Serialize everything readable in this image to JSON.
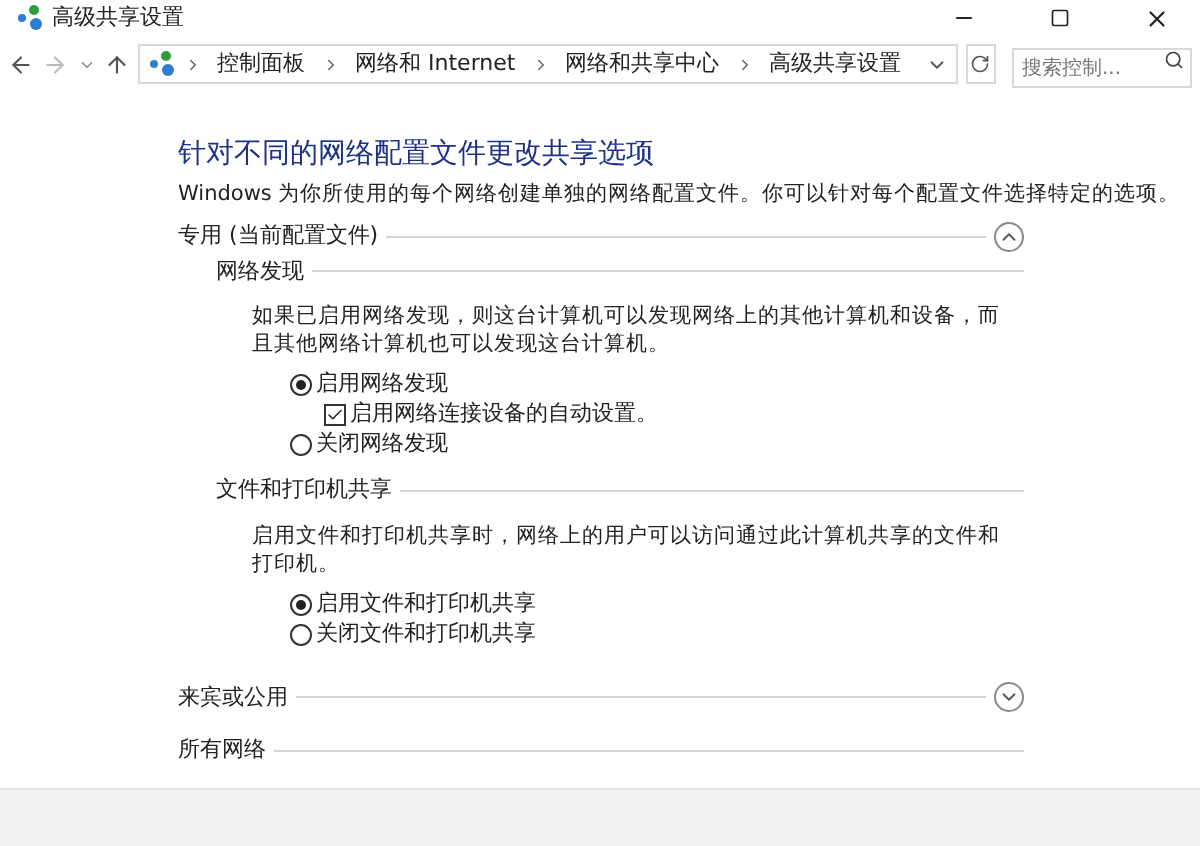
{
  "window": {
    "title": "高级共享设置"
  },
  "breadcrumb": [
    "控制面板",
    "网络和 Internet",
    "网络和共享中心",
    "高级共享设置"
  ],
  "search": {
    "placeholder": "搜索控制..."
  },
  "heading": "针对不同的网络配置文件更改共享选项",
  "description": "Windows 为你所使用的每个网络创建单独的网络配置文件。你可以针对每个配置文件选择特定的选项。",
  "sections": [
    {
      "title": "专用 (当前配置文件)",
      "expanded": true,
      "subsections": [
        {
          "title": "网络发现",
          "description": "如果已启用网络发现，则这台计算机可以发现网络上的其他计算机和设备，而且其他网络计算机也可以发现这台计算机。",
          "options": [
            {
              "label": "启用网络发现",
              "selected": true,
              "children": [
                {
                  "label": "启用网络连接设备的自动设置。",
                  "checked": true
                }
              ]
            },
            {
              "label": "关闭网络发现",
              "selected": false
            }
          ]
        },
        {
          "title": "文件和打印机共享",
          "description": "启用文件和打印机共享时，网络上的用户可以访问通过此计算机共享的文件和打印机。",
          "options": [
            {
              "label": "启用文件和打印机共享",
              "selected": true
            },
            {
              "label": "关闭文件和打印机共享",
              "selected": false
            }
          ]
        }
      ]
    },
    {
      "title": "来宾或公用",
      "expanded": false
    },
    {
      "title": "所有网络"
    }
  ]
}
